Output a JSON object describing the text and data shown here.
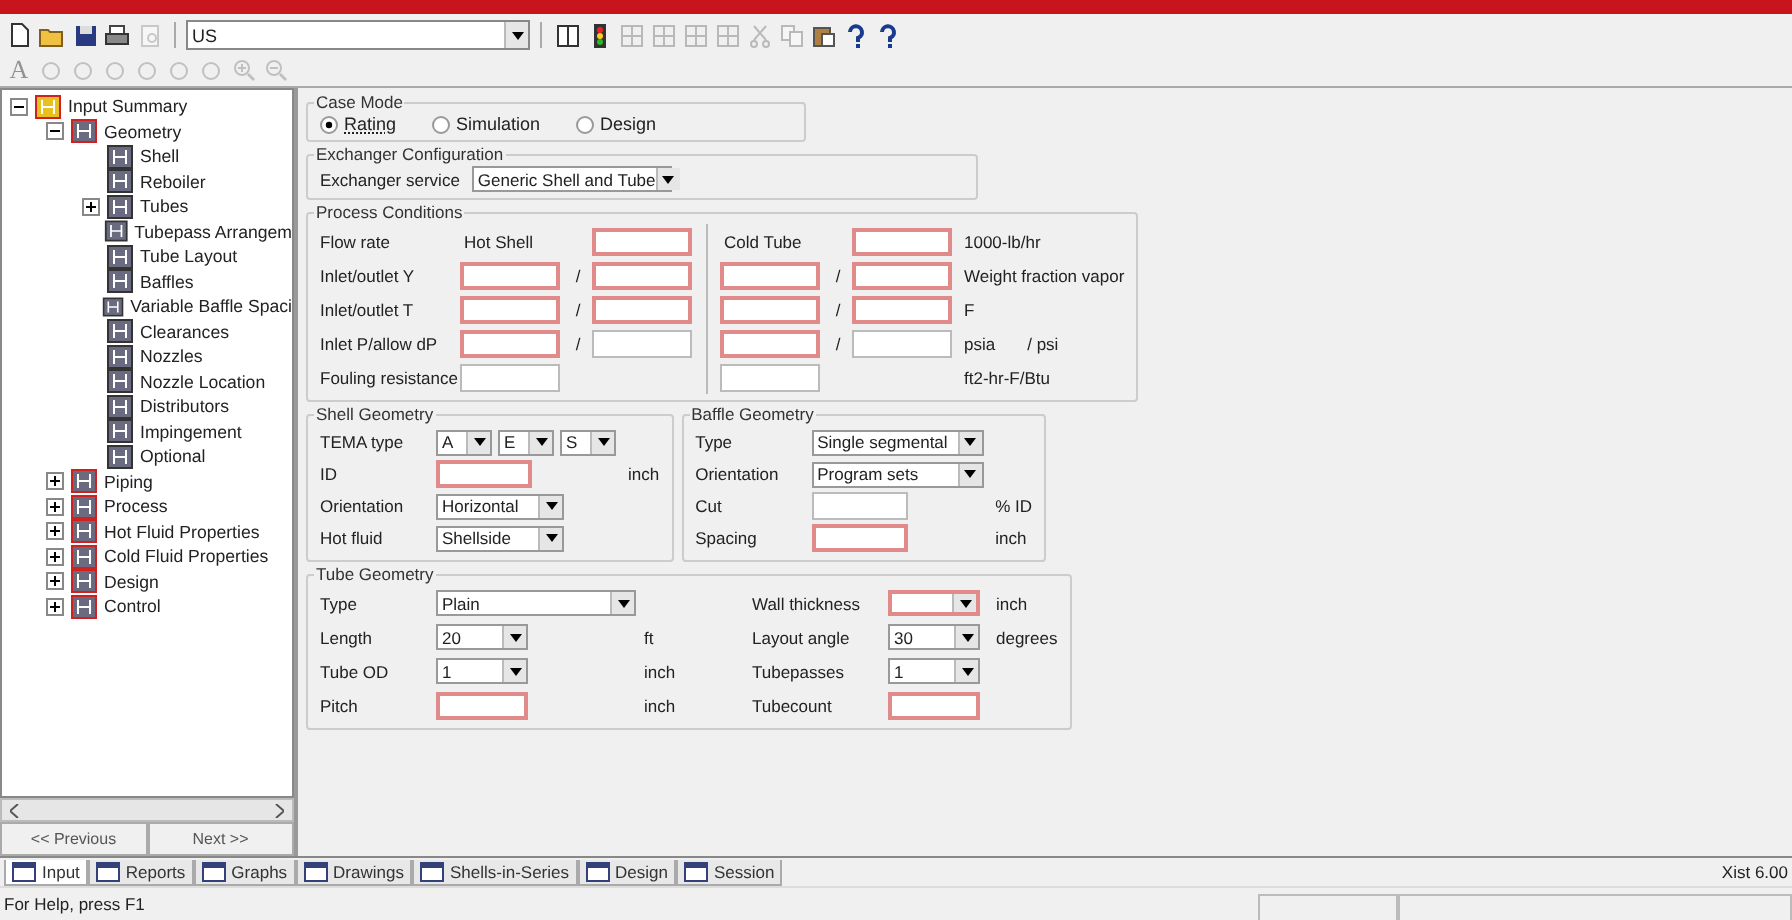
{
  "toolbar": {
    "row1_left": [
      {
        "kind": "page",
        "disabled": false
      },
      {
        "kind": "folder",
        "disabled": false
      },
      {
        "kind": "disk",
        "disabled": false
      },
      {
        "kind": "printer",
        "disabled": false
      },
      {
        "kind": "preview",
        "disabled": true
      }
    ],
    "units": {
      "value": "US"
    },
    "row1_right": [
      {
        "kind": "columns",
        "disabled": false
      },
      {
        "kind": "traffic-light",
        "disabled": false
      },
      {
        "kind": "grid",
        "disabled": true
      },
      {
        "kind": "grid",
        "disabled": true
      },
      {
        "kind": "grid",
        "disabled": true
      },
      {
        "kind": "grid",
        "disabled": true
      },
      {
        "kind": "scissors",
        "disabled": true
      },
      {
        "kind": "copy",
        "disabled": true
      },
      {
        "kind": "clipboard",
        "disabled": false
      },
      {
        "kind": "question",
        "disabled": false
      },
      {
        "kind": "question-arrow",
        "disabled": false
      }
    ],
    "row2": [
      {
        "kind": "letter",
        "text": "A",
        "disabled": true
      },
      {
        "kind": "circle",
        "disabled": true
      },
      {
        "kind": "circle",
        "disabled": true
      },
      {
        "kind": "circle",
        "disabled": true
      },
      {
        "kind": "circle",
        "disabled": true
      },
      {
        "kind": "circle",
        "disabled": true
      },
      {
        "kind": "circle",
        "disabled": true
      },
      {
        "kind": "zoom-in",
        "disabled": true
      },
      {
        "kind": "zoom-out",
        "disabled": true
      }
    ]
  },
  "tree": [
    {
      "label": "Input Summary",
      "expanded": true,
      "children": [
        {
          "label": "Geometry",
          "expanded": true,
          "children": [
            {
              "label": "Shell"
            },
            {
              "label": "Reboiler"
            },
            {
              "label": "Tubes",
              "expanded": false
            },
            {
              "label": "Tubepass Arrangem"
            },
            {
              "label": "Tube Layout"
            },
            {
              "label": "Baffles"
            },
            {
              "label": "Variable Baffle Spaci"
            },
            {
              "label": "Clearances"
            },
            {
              "label": "Nozzles"
            },
            {
              "label": "Nozzle Location"
            },
            {
              "label": "Distributors"
            },
            {
              "label": "Impingement"
            },
            {
              "label": "Optional"
            }
          ]
        },
        {
          "label": "Piping",
          "expanded": false
        },
        {
          "label": "Process",
          "expanded": false
        },
        {
          "label": "Hot Fluid Properties",
          "expanded": false
        },
        {
          "label": "Cold Fluid Properties",
          "expanded": false
        },
        {
          "label": "Design",
          "expanded": false
        },
        {
          "label": "Control",
          "expanded": false
        }
      ]
    }
  ],
  "nav": {
    "previous": "<< Previous",
    "next": "Next >>"
  },
  "case_mode": {
    "title": "Case Mode",
    "options": [
      {
        "label": "Rating",
        "selected": true
      },
      {
        "label": "Simulation",
        "selected": false
      },
      {
        "label": "Design",
        "selected": false
      }
    ]
  },
  "exchanger_configuration": {
    "title": "Exchanger Configuration",
    "label": "Exchanger service",
    "value": "Generic Shell and Tube"
  },
  "process_conditions": {
    "title": "Process Conditions",
    "rows": [
      {
        "label": "Flow rate",
        "hot_in": {
          "kind": "text",
          "text": "Hot Shell"
        },
        "hot_out": {
          "kind": "field",
          "required": true
        },
        "cold_in": {
          "kind": "text",
          "text": "Cold Tube"
        },
        "cold_out": {
          "kind": "field",
          "required": true
        },
        "units": [
          "1000-lb/hr"
        ]
      },
      {
        "label": "Inlet/outlet Y",
        "hot_in": {
          "kind": "field",
          "required": true
        },
        "hot_out": {
          "kind": "field",
          "required": true
        },
        "cold_in": {
          "kind": "field",
          "required": true
        },
        "cold_out": {
          "kind": "field",
          "required": true
        },
        "separators": [
          "/",
          "/"
        ],
        "units": [
          "Weight fraction vapor"
        ]
      },
      {
        "label": "Inlet/outlet T",
        "hot_in": {
          "kind": "field",
          "required": true
        },
        "hot_out": {
          "kind": "field",
          "required": true
        },
        "cold_in": {
          "kind": "field",
          "required": true
        },
        "cold_out": {
          "kind": "field",
          "required": true
        },
        "separators": [
          "/",
          "/"
        ],
        "units": [
          "F"
        ]
      },
      {
        "label": "Inlet P/allow dP",
        "hot_in": {
          "kind": "field",
          "required": true
        },
        "hot_out": {
          "kind": "field",
          "required": false
        },
        "cold_in": {
          "kind": "field",
          "required": true
        },
        "cold_out": {
          "kind": "field",
          "required": false
        },
        "separators": [
          "/",
          "/"
        ],
        "units": [
          "psia",
          "/ psi"
        ]
      },
      {
        "label": "Fouling resistance",
        "hot_in": {
          "kind": "field",
          "required": false
        },
        "cold_in": {
          "kind": "field",
          "required": false
        },
        "units": [
          "ft2-hr-F/Btu"
        ]
      }
    ]
  },
  "shell_geometry": {
    "title": "Shell Geometry",
    "rows": [
      {
        "label": "TEMA type",
        "controls": [
          {
            "kind": "select",
            "value": "A",
            "required": false
          },
          {
            "kind": "select",
            "value": "E",
            "required": false
          },
          {
            "kind": "select",
            "value": "S",
            "required": false
          }
        ]
      },
      {
        "label": "ID",
        "controls": [
          {
            "kind": "field",
            "required": true
          }
        ],
        "unit": "inch"
      },
      {
        "label": "Orientation",
        "controls": [
          {
            "kind": "select",
            "value": "Horizontal",
            "required": false
          }
        ]
      },
      {
        "label": "Hot fluid",
        "controls": [
          {
            "kind": "select",
            "value": "Shellside",
            "required": false
          }
        ]
      }
    ]
  },
  "baffle_geometry": {
    "title": "Baffle Geometry",
    "rows": [
      {
        "label": "Type",
        "controls": [
          {
            "kind": "select",
            "value": "Single segmental",
            "required": false
          }
        ]
      },
      {
        "label": "Orientation",
        "controls": [
          {
            "kind": "select",
            "value": "Program sets",
            "required": false
          }
        ]
      },
      {
        "label": "Cut",
        "controls": [
          {
            "kind": "field",
            "required": false
          }
        ],
        "unit": "% ID"
      },
      {
        "label": "Spacing",
        "controls": [
          {
            "kind": "field",
            "required": true
          }
        ],
        "unit": "inch"
      }
    ]
  },
  "tube_geometry": {
    "title": "Tube Geometry",
    "rows": [
      {
        "label": "Type",
        "controls": [
          {
            "kind": "select",
            "value": "Plain",
            "required": false
          }
        ]
      },
      {
        "label": "Wall thickness",
        "controls": [
          {
            "kind": "select",
            "required": true
          }
        ],
        "unit": "inch"
      },
      {
        "label": "Length",
        "controls": [
          {
            "kind": "select",
            "value": "20",
            "required": false
          }
        ],
        "unit": "ft"
      },
      {
        "label": "Layout angle",
        "controls": [
          {
            "kind": "select",
            "value": "30",
            "required": false
          }
        ],
        "unit": "degrees"
      },
      {
        "label": "Tube OD",
        "controls": [
          {
            "kind": "select",
            "value": "1",
            "required": false
          }
        ],
        "unit": "inch"
      },
      {
        "label": "Tubepasses",
        "controls": [
          {
            "kind": "select",
            "value": "1",
            "required": false
          }
        ]
      },
      {
        "label": "Pitch",
        "controls": [
          {
            "kind": "field",
            "required": true
          }
        ],
        "unit": "inch"
      },
      {
        "label": "Tubecount",
        "controls": [
          {
            "kind": "field",
            "required": true
          }
        ]
      }
    ]
  },
  "tabs": [
    {
      "label": "Input",
      "selected": true
    },
    {
      "label": "Reports",
      "selected": false
    },
    {
      "label": "Graphs",
      "selected": false
    },
    {
      "label": "Drawings",
      "selected": false
    },
    {
      "label": "Shells-in-Series",
      "selected": false
    },
    {
      "label": "Design",
      "selected": false
    },
    {
      "label": "Session",
      "selected": false
    }
  ],
  "version": "Xist 6.00",
  "status_bar": {
    "text": "For Help, press F1"
  }
}
